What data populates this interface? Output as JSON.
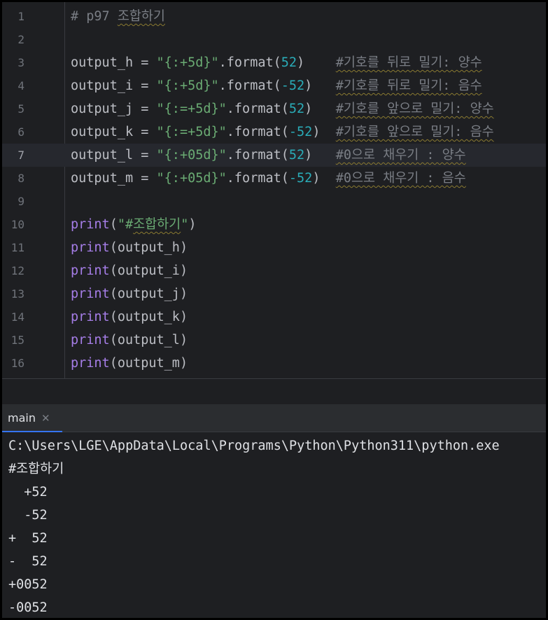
{
  "editor": {
    "lines": [
      {
        "n": "1",
        "parts": [
          {
            "t": "# p97 ",
            "c": "cmt"
          },
          {
            "t": "조합하기",
            "c": "cmt sq"
          }
        ]
      },
      {
        "n": "2",
        "parts": []
      },
      {
        "n": "3",
        "parts": [
          {
            "t": "output_h = ",
            "c": ""
          },
          {
            "t": "\"{:+5d}\"",
            "c": "str"
          },
          {
            "t": ".format(",
            "c": ""
          },
          {
            "t": "52",
            "c": "num"
          },
          {
            "t": ")    ",
            "c": ""
          },
          {
            "t": "#기호를 뒤로 밀기: 양수",
            "c": "cmt sq"
          }
        ]
      },
      {
        "n": "4",
        "parts": [
          {
            "t": "output_i = ",
            "c": ""
          },
          {
            "t": "\"{:+5d}\"",
            "c": "str"
          },
          {
            "t": ".format(",
            "c": ""
          },
          {
            "t": "-52",
            "c": "num"
          },
          {
            "t": ")   ",
            "c": ""
          },
          {
            "t": "#기호를 뒤로 밀기: 음수",
            "c": "cmt sq"
          }
        ]
      },
      {
        "n": "5",
        "parts": [
          {
            "t": "output_j = ",
            "c": ""
          },
          {
            "t": "\"{:=+5d}\"",
            "c": "str"
          },
          {
            "t": ".format(",
            "c": ""
          },
          {
            "t": "52",
            "c": "num"
          },
          {
            "t": ")   ",
            "c": ""
          },
          {
            "t": "#기호를 앞으로 밀기: 양수",
            "c": "cmt sq"
          }
        ]
      },
      {
        "n": "6",
        "parts": [
          {
            "t": "output_k = ",
            "c": ""
          },
          {
            "t": "\"{:=+5d}\"",
            "c": "str"
          },
          {
            "t": ".format(",
            "c": ""
          },
          {
            "t": "-52",
            "c": "num"
          },
          {
            "t": ")  ",
            "c": ""
          },
          {
            "t": "#기호를 앞으로 밀기: 음수",
            "c": "cmt sq"
          }
        ]
      },
      {
        "n": "7",
        "parts": [
          {
            "t": "output_l = ",
            "c": ""
          },
          {
            "t": "\"{:+05d}\"",
            "c": "str"
          },
          {
            "t": ".format(",
            "c": ""
          },
          {
            "t": "52",
            "c": "num"
          },
          {
            "t": ")   ",
            "c": ""
          },
          {
            "t": "#0으로 채우기 : 양수",
            "c": "cmt sq"
          }
        ],
        "current": true
      },
      {
        "n": "8",
        "parts": [
          {
            "t": "output_m = ",
            "c": ""
          },
          {
            "t": "\"{:+05d}\"",
            "c": "str"
          },
          {
            "t": ".format(",
            "c": ""
          },
          {
            "t": "-52",
            "c": "num"
          },
          {
            "t": ")  ",
            "c": ""
          },
          {
            "t": "#0으로 채우기 : 음수",
            "c": "cmt sq"
          }
        ]
      },
      {
        "n": "9",
        "parts": []
      },
      {
        "n": "10",
        "parts": [
          {
            "t": "print",
            "c": "kw-fn"
          },
          {
            "t": "(",
            "c": ""
          },
          {
            "t": "\"#",
            "c": "str"
          },
          {
            "t": "조합하기",
            "c": "str sq"
          },
          {
            "t": "\"",
            "c": "str"
          },
          {
            "t": ")",
            "c": ""
          }
        ]
      },
      {
        "n": "11",
        "parts": [
          {
            "t": "print",
            "c": "kw-fn"
          },
          {
            "t": "(output_h)",
            "c": ""
          }
        ]
      },
      {
        "n": "12",
        "parts": [
          {
            "t": "print",
            "c": "kw-fn"
          },
          {
            "t": "(output_i)",
            "c": ""
          }
        ]
      },
      {
        "n": "13",
        "parts": [
          {
            "t": "print",
            "c": "kw-fn"
          },
          {
            "t": "(output_j)",
            "c": ""
          }
        ]
      },
      {
        "n": "14",
        "parts": [
          {
            "t": "print",
            "c": "kw-fn"
          },
          {
            "t": "(output_k)",
            "c": ""
          }
        ]
      },
      {
        "n": "15",
        "parts": [
          {
            "t": "print",
            "c": "kw-fn"
          },
          {
            "t": "(output_l)",
            "c": ""
          }
        ]
      },
      {
        "n": "16",
        "parts": [
          {
            "t": "print",
            "c": "kw-fn"
          },
          {
            "t": "(output_m)",
            "c": ""
          }
        ]
      }
    ]
  },
  "run_panel": {
    "tab_label": "main",
    "close_glyph": "✕"
  },
  "console": {
    "lines": [
      "C:\\Users\\LGE\\AppData\\Local\\Programs\\Python\\Python311\\python.exe",
      "#조합하기",
      "  +52",
      "  -52",
      "+  52",
      "-  52",
      "+0052",
      "-0052"
    ]
  }
}
